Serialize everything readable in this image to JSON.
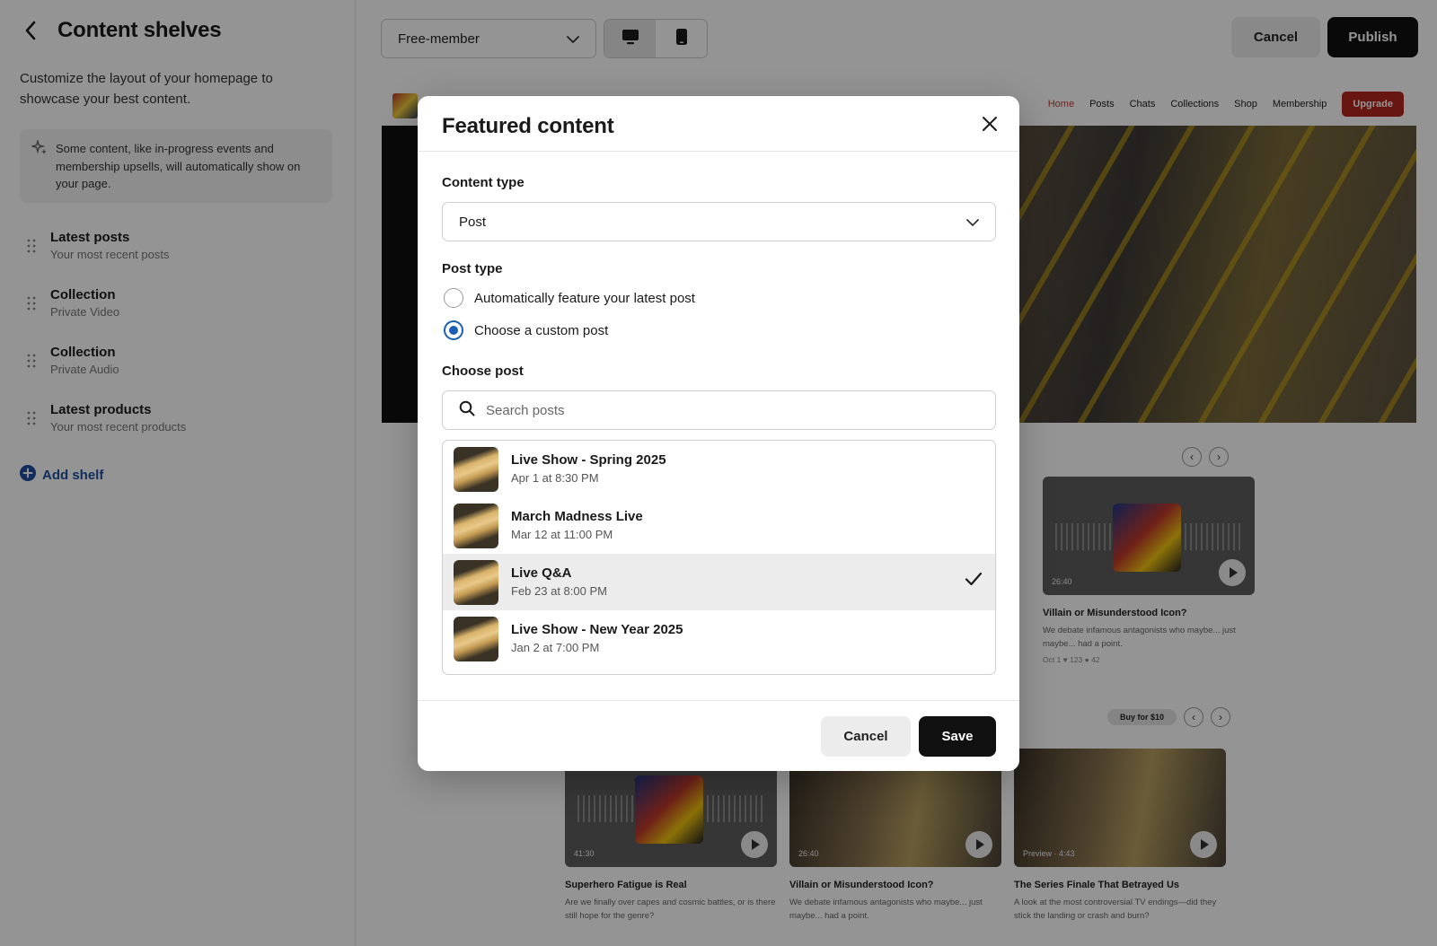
{
  "sidebar": {
    "title": "Content shelves",
    "description": "Customize the layout of your homepage to showcase your best content.",
    "note": "Some content, like in-progress events and membership upsells, will automatically show on your page.",
    "shelves": [
      {
        "title": "Latest posts",
        "subtitle": "Your most recent posts"
      },
      {
        "title": "Collection",
        "subtitle": "Private Video"
      },
      {
        "title": "Collection",
        "subtitle": "Private Audio"
      },
      {
        "title": "Latest products",
        "subtitle": "Your most recent products"
      }
    ],
    "add_shelf": "Add shelf"
  },
  "toolbar": {
    "audience": "Free-member",
    "cancel": "Cancel",
    "publish": "Publish"
  },
  "preview": {
    "nav": [
      "Home",
      "Posts",
      "Chats",
      "Collections",
      "Shop",
      "Membership"
    ],
    "upgrade": "Upgrade",
    "buy": "Buy for $10",
    "cards": [
      {
        "title": "Villain or Misunderstood Icon?",
        "desc": "We debate infamous antagonists who maybe... just maybe... had a point.",
        "meta": "Oct 1   ♥ 123   ● 42",
        "duration": "26:40"
      },
      {
        "title": "Superhero Fatigue is Real",
        "desc": "Are we finally over capes and cosmic battles, or is there still hope for the genre?",
        "duration": "41:30"
      },
      {
        "title": "Villain or Misunderstood Icon?",
        "desc": "We debate infamous antagonists who maybe... just maybe... had a point.",
        "duration": "26:40"
      },
      {
        "title": "The Series Finale That Betrayed Us",
        "desc": "A look at the most controversial TV endings—did they stick the landing or crash and burn?",
        "duration": "Preview · 4:43"
      }
    ]
  },
  "modal": {
    "title": "Featured content",
    "content_type_label": "Content type",
    "content_type_value": "Post",
    "post_type_label": "Post type",
    "radio_auto": "Automatically feature your latest post",
    "radio_custom": "Choose a custom post",
    "choose_post_label": "Choose post",
    "search_placeholder": "Search posts",
    "posts": [
      {
        "title": "Live Show - Spring 2025",
        "date": "Apr 1 at 8:30 PM",
        "selected": false
      },
      {
        "title": "March Madness Live",
        "date": "Mar 12 at 11:00 PM",
        "selected": false
      },
      {
        "title": "Live Q&A",
        "date": "Feb 23 at 8:00 PM",
        "selected": true
      },
      {
        "title": "Live Show - New Year 2025",
        "date": "Jan 2 at 7:00 PM",
        "selected": false
      }
    ],
    "cancel": "Cancel",
    "save": "Save"
  },
  "colors": {
    "accent_blue": "#1a5fb4",
    "link_blue": "#1f4f9e",
    "primary_button": "#111111",
    "upgrade_red": "#b3261e"
  }
}
